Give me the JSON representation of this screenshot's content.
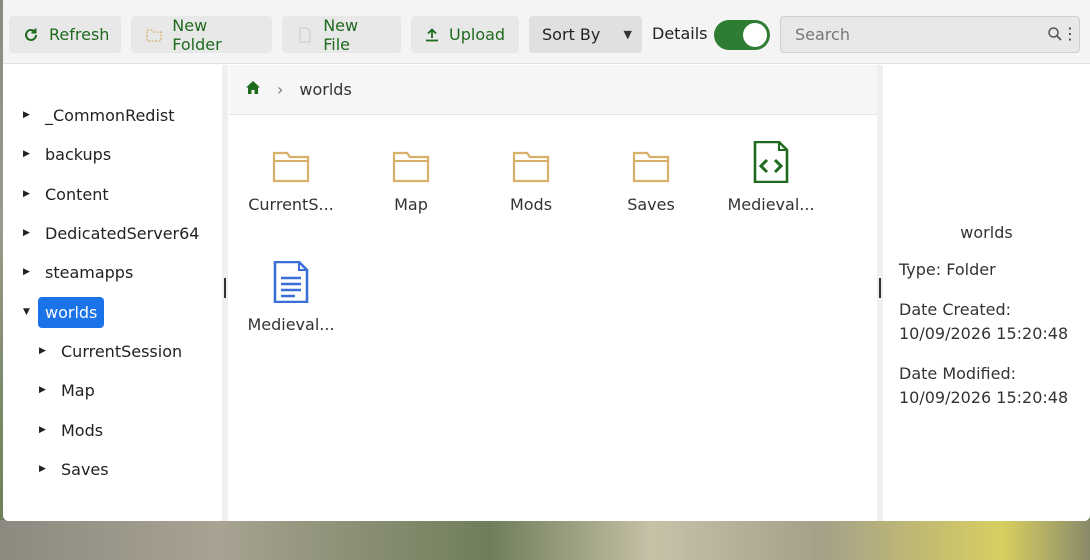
{
  "toolbar": {
    "refresh": "Refresh",
    "new_folder": "New Folder",
    "new_file": "New File",
    "upload": "Upload",
    "sort_by": "Sort By",
    "details": "Details",
    "details_on": true,
    "search_placeholder": "Search"
  },
  "tree": {
    "items": [
      {
        "label": "_CommonRedist"
      },
      {
        "label": "backups"
      },
      {
        "label": "Content"
      },
      {
        "label": "DedicatedServer64"
      },
      {
        "label": "steamapps"
      },
      {
        "label": "worlds",
        "expanded": true,
        "selected": true
      },
      {
        "label": "CurrentSession"
      },
      {
        "label": "Map"
      },
      {
        "label": "Mods"
      },
      {
        "label": "Saves"
      }
    ]
  },
  "breadcrumb": {
    "current": "worlds"
  },
  "files": [
    {
      "label": "CurrentS...",
      "icon": "folder-icon"
    },
    {
      "label": "Map",
      "icon": "folder-icon"
    },
    {
      "label": "Mods",
      "icon": "folder-icon"
    },
    {
      "label": "Saves",
      "icon": "folder-icon"
    },
    {
      "label": "Medieval...",
      "icon": "code-file-icon"
    },
    {
      "label": "Medieval...",
      "icon": "text-file-icon"
    }
  ],
  "details_panel": {
    "title": "worlds",
    "type": "Type: Folder",
    "created_label": "Date Created:",
    "created_value": "10/09/2026 15:20:48",
    "modified_label": "Date Modified:",
    "modified_value": "10/09/2026 15:20:48"
  },
  "colors": {
    "accent_green": "#1e6b1e",
    "selection_blue": "#1a73e8",
    "folder": "#d8b06a",
    "text_file": "#3a6fd8"
  }
}
